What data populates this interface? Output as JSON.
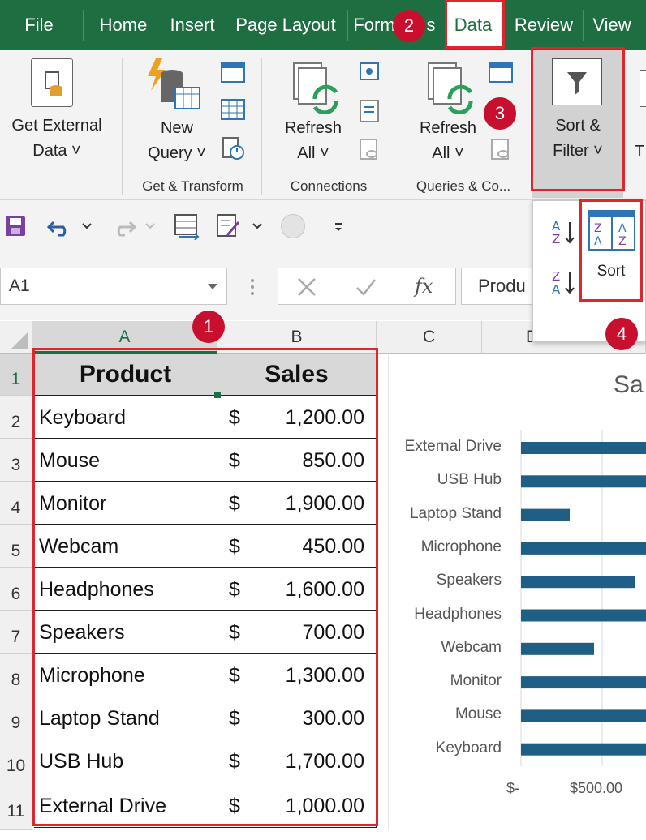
{
  "menu": {
    "file": "File",
    "home": "Home",
    "insert": "Insert",
    "page_layout": "Page Layout",
    "formulas": "Form",
    "formulas_tail": "s",
    "data": "Data",
    "review": "Review",
    "view": "View"
  },
  "ribbon": {
    "get_external_line1": "Get External",
    "get_external_line2": "Data ˅",
    "new_query_line1": "New",
    "new_query_line2": "Query ˅",
    "group_get_transform": "Get & Transform",
    "refresh_all_line1": "Refresh",
    "refresh_all_line2": "All ˅",
    "group_connections": "Connections",
    "refresh2_line1": "Refresh",
    "refresh2_line2": "All ˅",
    "group_queries": "Queries & Co...",
    "sort_filter_line1": "Sort &",
    "sort_filter_line2": "Filter ˅",
    "cut_letter": "T"
  },
  "dropdown": {
    "sort_label": "Sort"
  },
  "name_box": "A1",
  "formula_text": "Produ",
  "badges": [
    "1",
    "2",
    "3",
    "4"
  ],
  "columns": [
    "A",
    "B",
    "C",
    "D"
  ],
  "rows": [
    "1",
    "2",
    "3",
    "4",
    "5",
    "6",
    "7",
    "8",
    "9",
    "10",
    "11"
  ],
  "table": {
    "headers": [
      "Product",
      "Sales"
    ],
    "currency": "$",
    "data": [
      [
        "Keyboard",
        "1,200.00"
      ],
      [
        "Mouse",
        "850.00"
      ],
      [
        "Monitor",
        "1,900.00"
      ],
      [
        "Webcam",
        "450.00"
      ],
      [
        "Headphones",
        "1,600.00"
      ],
      [
        "Speakers",
        "700.00"
      ],
      [
        "Microphone",
        "1,300.00"
      ],
      [
        "Laptop Stand",
        "300.00"
      ],
      [
        "USB Hub",
        "1,700.00"
      ],
      [
        "External Drive",
        "1,000.00"
      ]
    ]
  },
  "colors": {
    "accent_green": "#1e6e42",
    "callout_red": "#c8102e",
    "bar_color": "#1f5f86"
  },
  "chart_data": {
    "type": "bar",
    "orientation": "horizontal",
    "title": "Sa",
    "categories": [
      "External Drive",
      "USB Hub",
      "Laptop Stand",
      "Microphone",
      "Speakers",
      "Headphones",
      "Webcam",
      "Monitor",
      "Mouse",
      "Keyboard"
    ],
    "values": [
      1000,
      1700,
      300,
      1300,
      700,
      1600,
      450,
      1900,
      850,
      1200
    ],
    "x_ticks": [
      "$-",
      "$500.00"
    ],
    "xlim": [
      0,
      2000
    ],
    "grid": true
  }
}
